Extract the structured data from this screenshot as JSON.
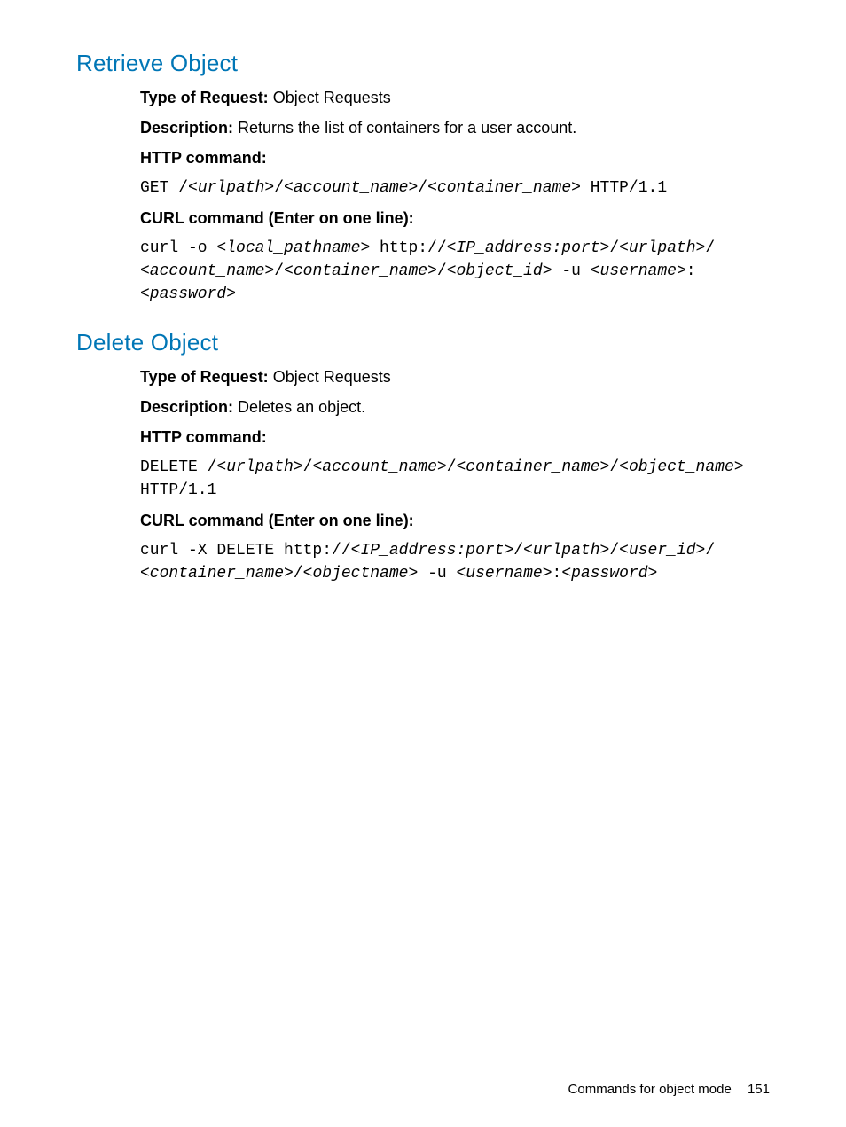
{
  "sections": [
    {
      "title": "Retrieve Object",
      "type_label": "Type of Request:",
      "type_value": "Object Requests",
      "desc_label": "Description:",
      "desc_value": "Returns the list of containers for a user account.",
      "http_label": "HTTP command:",
      "http_parts": {
        "p0": "GET /",
        "p1": "<urlpath>",
        "p2": "/",
        "p3": "<account_name>",
        "p4": "/",
        "p5": "<container_name>",
        "p6": " HTTP/1.1"
      },
      "curl_label": "CURL command (Enter on one line):",
      "curl_parts": {
        "c0": "curl -o ",
        "c1": "<local_pathname>",
        "c2": " http://",
        "c3": "<IP_address:port>",
        "c4": "/",
        "c5": "<urlpath>",
        "c6": "/",
        "c7": "<account_name>",
        "c8": "/",
        "c9": "<container_name>",
        "c10": "/",
        "c11": "<object_id>",
        "c12": " -u ",
        "c13": "<username>",
        "c14": ":",
        "c15": "<password>"
      }
    },
    {
      "title": "Delete Object",
      "type_label": "Type of Request:",
      "type_value": "Object Requests",
      "desc_label": "Description:",
      "desc_value": "Deletes an object.",
      "http_label": "HTTP command:",
      "http_parts": {
        "p0": "DELETE /",
        "p1": "<urlpath>",
        "p2": "/",
        "p3": "<account_name>",
        "p4": "/",
        "p5": "<container_name>",
        "p6": "/",
        "p7": "<object_name>",
        "p8": " HTTP/1.1"
      },
      "curl_label": "CURL command (Enter on one line):",
      "curl_parts": {
        "c0": "curl -X DELETE http://",
        "c1": "<IP_address:port>",
        "c2": "/",
        "c3": "<urlpath>",
        "c4": "/",
        "c5": "<user_id>",
        "c6": "/",
        "c7": "<container_name>",
        "c8": "/",
        "c9": "<objectname>",
        "c10": " -u ",
        "c11": "<username>",
        "c12": ":",
        "c13": "<password>"
      }
    }
  ],
  "footer": {
    "text": "Commands for object mode",
    "page": "151"
  }
}
